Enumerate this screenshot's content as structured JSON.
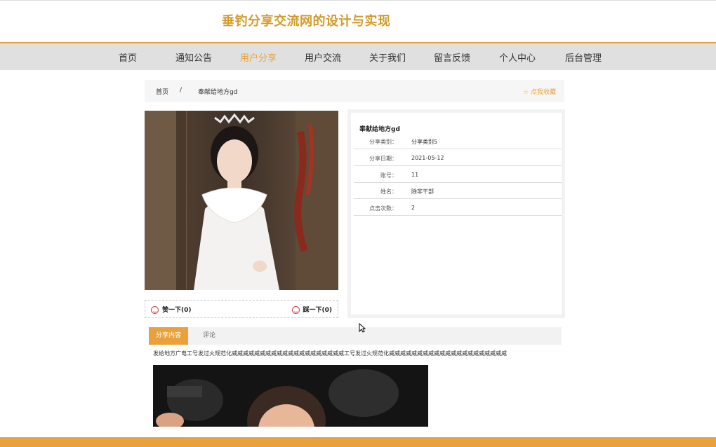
{
  "site": {
    "title": "垂钓分享交流网的设计与实现"
  },
  "nav": [
    {
      "label": "首页"
    },
    {
      "label": "通知公告"
    },
    {
      "label": "用户分享",
      "active": true
    },
    {
      "label": "用户交流"
    },
    {
      "label": "关于我们"
    },
    {
      "label": "留言反馈"
    },
    {
      "label": "个人中心"
    },
    {
      "label": "后台管理"
    }
  ],
  "breadcrumb": {
    "home": "首页",
    "separator": "/",
    "current": "奉献给地方gd",
    "favorite": "☆ 点我收藏"
  },
  "detail": {
    "title": "奉献给地方gd",
    "fields": [
      {
        "label": "分享类别：",
        "value": "分享类别5"
      },
      {
        "label": "分享日期：",
        "value": "2021-05-12"
      },
      {
        "label": "账号：",
        "value": "11"
      },
      {
        "label": "姓名：",
        "value": "除非干部"
      },
      {
        "label": "点击次数：",
        "value": "2"
      }
    ]
  },
  "votes": {
    "up": "赞一下(0)",
    "down": "踩一下(0)"
  },
  "tabs": {
    "content": "分享内容",
    "comments": "评论"
  },
  "content": {
    "text": "发给地方广电工号发过火规范化威威威威威威威威威威威威威威威威威威威威工号发过火规范化威威威威威威威威威威威威威威威威威威威威威"
  },
  "colors": {
    "accent": "#e9a23b",
    "title": "#d39b2a",
    "nav_bg": "#e0e0e0"
  }
}
